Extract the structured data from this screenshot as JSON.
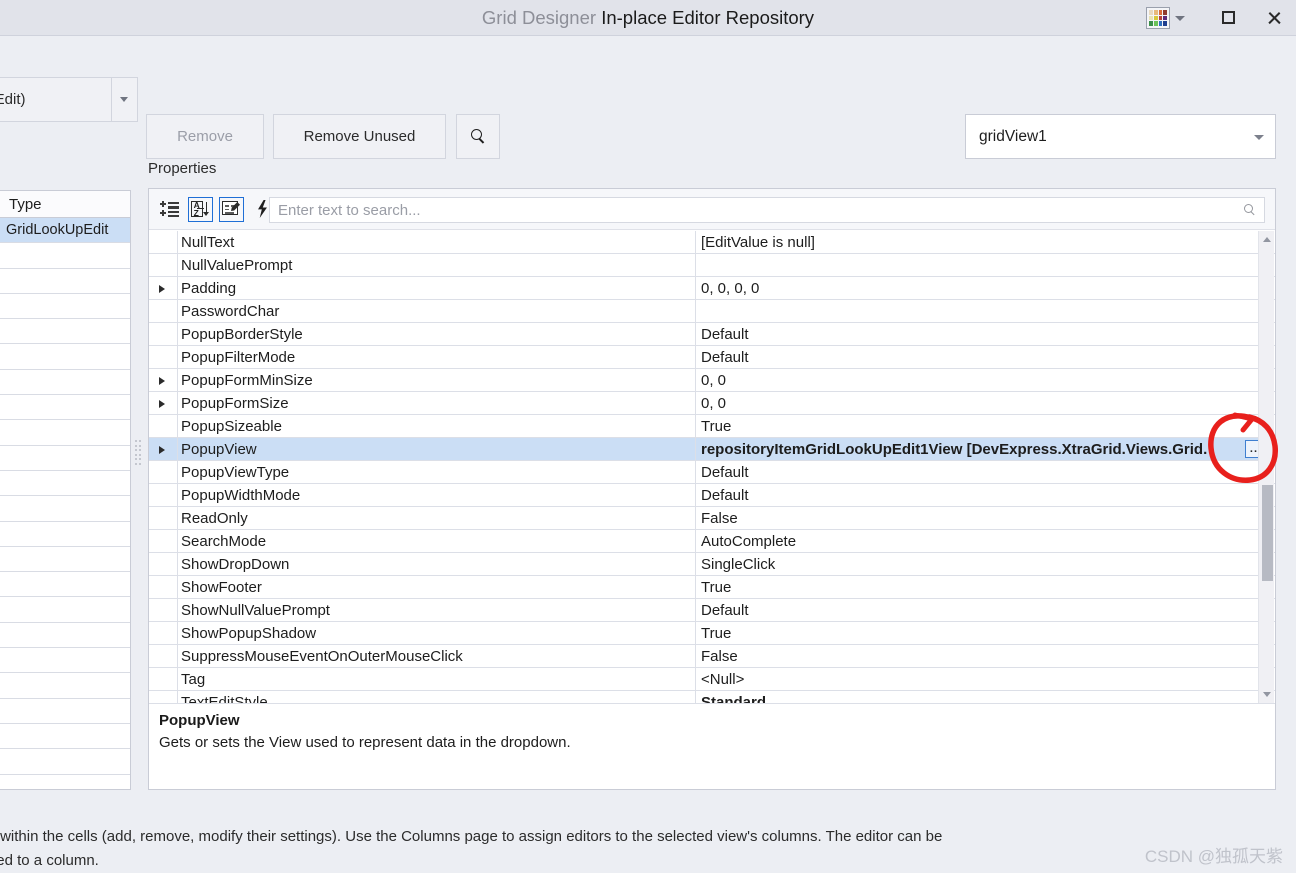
{
  "window": {
    "title_prefix": "Grid Designer",
    "title_main": "In-place Editor Repository",
    "skin_icon": "color-palette-grid-icon",
    "skin_caret_icon": "chevron-down-icon",
    "maximize_icon": "maximize-icon",
    "close_icon": "close-icon",
    "skin_colors": [
      "#e8d9c0",
      "#e8b97a",
      "#d96a3a",
      "#8f3a2e",
      "#e8e2b4",
      "#d9c83a",
      "#b4423a",
      "#5d2a7a",
      "#3a8f4a",
      "#6ac25a",
      "#2f6fc0",
      "#1f3f8f"
    ]
  },
  "toolbar": {
    "editor_combo_value": "xtEdit)",
    "editor_combo_caret_icon": "chevron-down-icon",
    "remove_label": "Remove",
    "remove_unused_label": "Remove Unused",
    "find_icon": "search-icon",
    "view_combo_value": "gridView1",
    "view_combo_caret_icon": "chevron-down-icon"
  },
  "type_list": {
    "header": "Type",
    "rows": [
      "GridLookUpEdit",
      "",
      "",
      "",
      "",
      "",
      "",
      "",
      "",
      "",
      "",
      "",
      "",
      "",
      "",
      "",
      "",
      "",
      "",
      "",
      "",
      ""
    ],
    "selected_index": 0,
    "splitter_icon": "splitter-grip-icon"
  },
  "properties_panel": {
    "label": "Properties",
    "toolbar_icons": [
      {
        "name": "categorized-icon",
        "active": false
      },
      {
        "name": "alphabetical-sort-icon",
        "active": true
      },
      {
        "name": "property-pages-icon",
        "active": true
      },
      {
        "name": "events-lightning-icon",
        "active": false
      }
    ],
    "search_placeholder": "Enter text to search...",
    "search_value": "",
    "search_icon": "search-icon",
    "rows": [
      {
        "name": "NullText",
        "value": "[EditValue is null]",
        "expandable": false,
        "bold": false,
        "selected": false
      },
      {
        "name": "NullValuePrompt",
        "value": "",
        "expandable": false,
        "bold": false,
        "selected": false
      },
      {
        "name": "Padding",
        "value": "0, 0, 0, 0",
        "expandable": true,
        "bold": false,
        "selected": false
      },
      {
        "name": "PasswordChar",
        "value": "",
        "expandable": false,
        "bold": false,
        "selected": false
      },
      {
        "name": "PopupBorderStyle",
        "value": "Default",
        "expandable": false,
        "bold": false,
        "selected": false
      },
      {
        "name": "PopupFilterMode",
        "value": "Default",
        "expandable": false,
        "bold": false,
        "selected": false
      },
      {
        "name": "PopupFormMinSize",
        "value": "0, 0",
        "expandable": true,
        "bold": false,
        "selected": false
      },
      {
        "name": "PopupFormSize",
        "value": "0, 0",
        "expandable": true,
        "bold": false,
        "selected": false
      },
      {
        "name": "PopupSizeable",
        "value": "True",
        "expandable": false,
        "bold": false,
        "selected": false
      },
      {
        "name": "PopupView",
        "value": "repositoryItemGridLookUpEdit1View [DevExpress.XtraGrid.Views.Grid.",
        "expandable": true,
        "bold": true,
        "selected": true,
        "ellipsis_button": "..."
      },
      {
        "name": "PopupViewType",
        "value": "Default",
        "expandable": false,
        "bold": false,
        "selected": false
      },
      {
        "name": "PopupWidthMode",
        "value": "Default",
        "expandable": false,
        "bold": false,
        "selected": false
      },
      {
        "name": "ReadOnly",
        "value": "False",
        "expandable": false,
        "bold": false,
        "selected": false
      },
      {
        "name": "SearchMode",
        "value": "AutoComplete",
        "expandable": false,
        "bold": false,
        "selected": false
      },
      {
        "name": "ShowDropDown",
        "value": "SingleClick",
        "expandable": false,
        "bold": false,
        "selected": false
      },
      {
        "name": "ShowFooter",
        "value": "True",
        "expandable": false,
        "bold": false,
        "selected": false
      },
      {
        "name": "ShowNullValuePrompt",
        "value": "Default",
        "expandable": false,
        "bold": false,
        "selected": false
      },
      {
        "name": "ShowPopupShadow",
        "value": "True",
        "expandable": false,
        "bold": false,
        "selected": false
      },
      {
        "name": "SuppressMouseEventOnOuterMouseClick",
        "value": "False",
        "expandable": false,
        "bold": false,
        "selected": false
      },
      {
        "name": "Tag",
        "value": "<Null>",
        "expandable": false,
        "bold": false,
        "selected": false
      },
      {
        "name": "TextEditStyle",
        "value": "Standard",
        "expandable": false,
        "bold": true,
        "selected": false
      }
    ],
    "scrollbar": {
      "up_icon": "scroll-up-arrow-icon",
      "down_icon": "scroll-down-arrow-icon",
      "thumb_top_pct": 54,
      "thumb_height_pct": 22
    },
    "description": {
      "title": "PopupView",
      "text": "Gets or sets the View used to represent data in the dropdown."
    }
  },
  "status": {
    "line1": "rs used for in-place editing within the cells (add, remove, modify their settings). Use the Columns page to assign editors to the selected view's columns. The editor can be",
    "line2": "e collection if it isn't assigned to a column."
  },
  "annotation": {
    "shape": "red-hand-drawn-ellipse",
    "color": "#e8201c",
    "target": "ellipsis-button"
  },
  "watermark": {
    "text": "CSDN @独孤天紫"
  }
}
